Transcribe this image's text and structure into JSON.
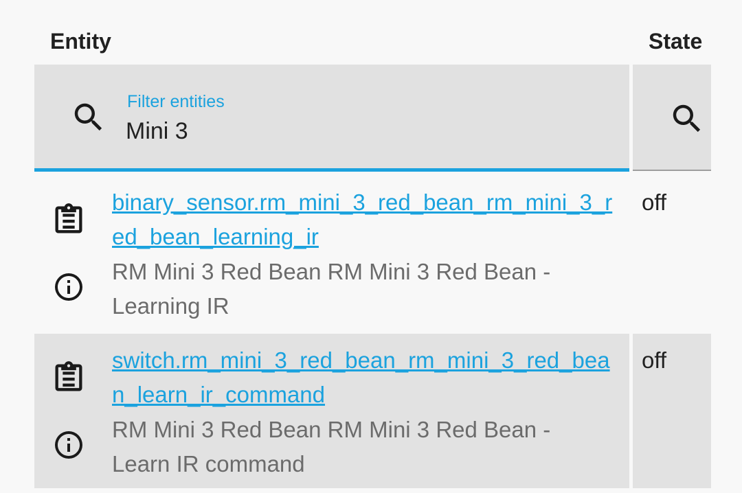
{
  "header": {
    "entity_label": "Entity",
    "state_label": "State"
  },
  "filter": {
    "label": "Filter entities",
    "value": "Mini 3"
  },
  "rows": [
    {
      "entity_id": "binary_sensor.rm_mini_3_red_bean_rm_mini_3_red_bean_learning_ir",
      "name": "RM Mini 3 Red Bean RM Mini 3 Red Bean - Learning IR",
      "state": "off"
    },
    {
      "entity_id": "switch.rm_mini_3_red_bean_rm_mini_3_red_bean_learn_ir_command",
      "name": "RM Mini 3 Red Bean RM Mini 3 Red Bean - Learn IR command",
      "state": "off"
    }
  ],
  "colors": {
    "accent": "#1ba2de",
    "filter_bg": "#e1e1e1",
    "row_alt_bg": "#e2e2e2",
    "secondary_text": "#6b6b6b"
  },
  "icons": {
    "search": "search-icon",
    "clipboard": "clipboard-text-icon",
    "info": "info-icon"
  }
}
